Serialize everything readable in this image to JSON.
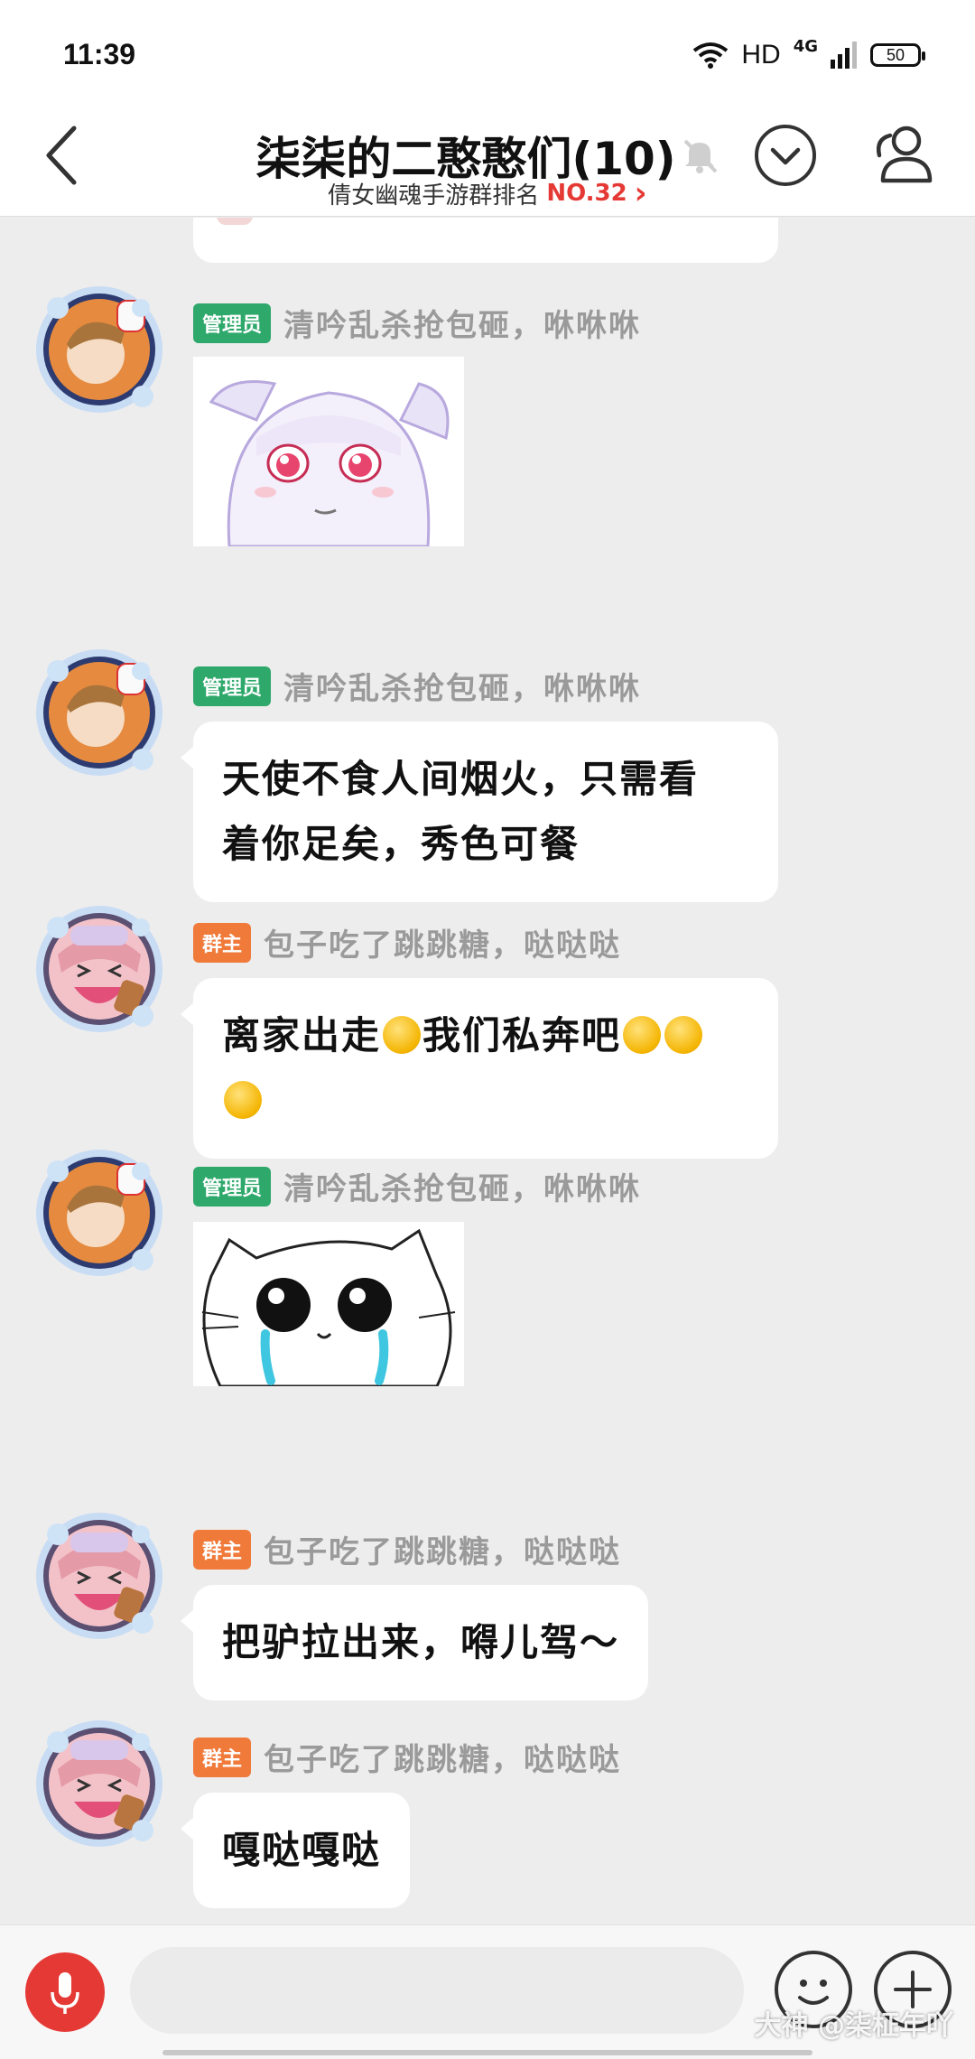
{
  "status_bar": {
    "time": "11:39",
    "hd": "HD",
    "network": "4G",
    "battery": "50"
  },
  "header": {
    "title": "柒柒的二憨憨们(10)",
    "rank_prefix": "倩女幽魂手游群排名",
    "rank": "NO.32",
    "rank_arrow": "›"
  },
  "messages": [
    {
      "role": "管理员",
      "sender": "清吟乱杀抢包砸，咻咻咻",
      "type": "sticker",
      "sticker_icon": "white-hair-anime-girl-sticker",
      "avatar_icon": "fox-mask-boy-avatar"
    },
    {
      "role": "管理员",
      "sender": "清吟乱杀抢包砸，咻咻咻",
      "type": "text",
      "text_line1": "天使不食人间烟火，只需看",
      "text_line2": "着你足矣，秀色可餐",
      "avatar_icon": "fox-mask-boy-avatar"
    },
    {
      "role": "群主",
      "sender": "包子吃了跳跳糖，哒哒哒",
      "type": "text",
      "text_part1": "离家出走",
      "text_part2": "我们私奔吧",
      "avatar_icon": "pink-hair-girl-avatar"
    },
    {
      "role": "管理员",
      "sender": "清吟乱杀抢包砸，咻咻咻",
      "type": "sticker",
      "sticker_icon": "crying-cat-sticker",
      "avatar_icon": "fox-mask-boy-avatar"
    },
    {
      "role": "群主",
      "sender": "包子吃了跳跳糖，哒哒哒",
      "type": "text",
      "text": "把驴拉出来，嘚儿驾～",
      "avatar_icon": "pink-hair-girl-avatar"
    },
    {
      "role": "群主",
      "sender": "包子吃了跳跳糖，哒哒哒",
      "type": "text",
      "text": "嘎哒嘎哒",
      "avatar_icon": "pink-hair-girl-avatar"
    }
  ],
  "input_bar": {
    "placeholder": "",
    "watermark": "大神 @柒柾年吖"
  },
  "colors": {
    "chat_bg": "#ededed",
    "admin_badge": "#2ea86b",
    "owner_badge": "#f07a3a",
    "rank_red": "#e53935",
    "voice_button": "#e53935"
  }
}
